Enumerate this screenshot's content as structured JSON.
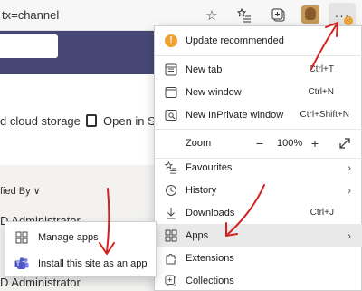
{
  "browser": {
    "address_text": "tx=channel"
  },
  "page": {
    "cmd_storage": "d cloud storage",
    "cmd_open": "Open in Sha",
    "modified_label": "fied By ∨",
    "row1": "D Administrator",
    "row2": "D Administrator"
  },
  "menu": {
    "update": "Update recommended",
    "new_tab": {
      "label": "New tab",
      "shortcut": "Ctrl+T"
    },
    "new_window": {
      "label": "New window",
      "shortcut": "Ctrl+N"
    },
    "inprivate": {
      "label": "New InPrivate window",
      "shortcut": "Ctrl+Shift+N"
    },
    "zoom": {
      "label": "Zoom",
      "value": "100%"
    },
    "favourites": "Favourites",
    "history": "History",
    "downloads": {
      "label": "Downloads",
      "shortcut": "Ctrl+J"
    },
    "apps": "Apps",
    "extensions": "Extensions",
    "collections": "Collections"
  },
  "submenu": {
    "manage_apps": "Manage apps",
    "install_site": "Install this site as an app"
  },
  "colors": {
    "accent_orange": "#f0a030",
    "annotation_red": "#d32020",
    "teams_purple": "#464775"
  }
}
